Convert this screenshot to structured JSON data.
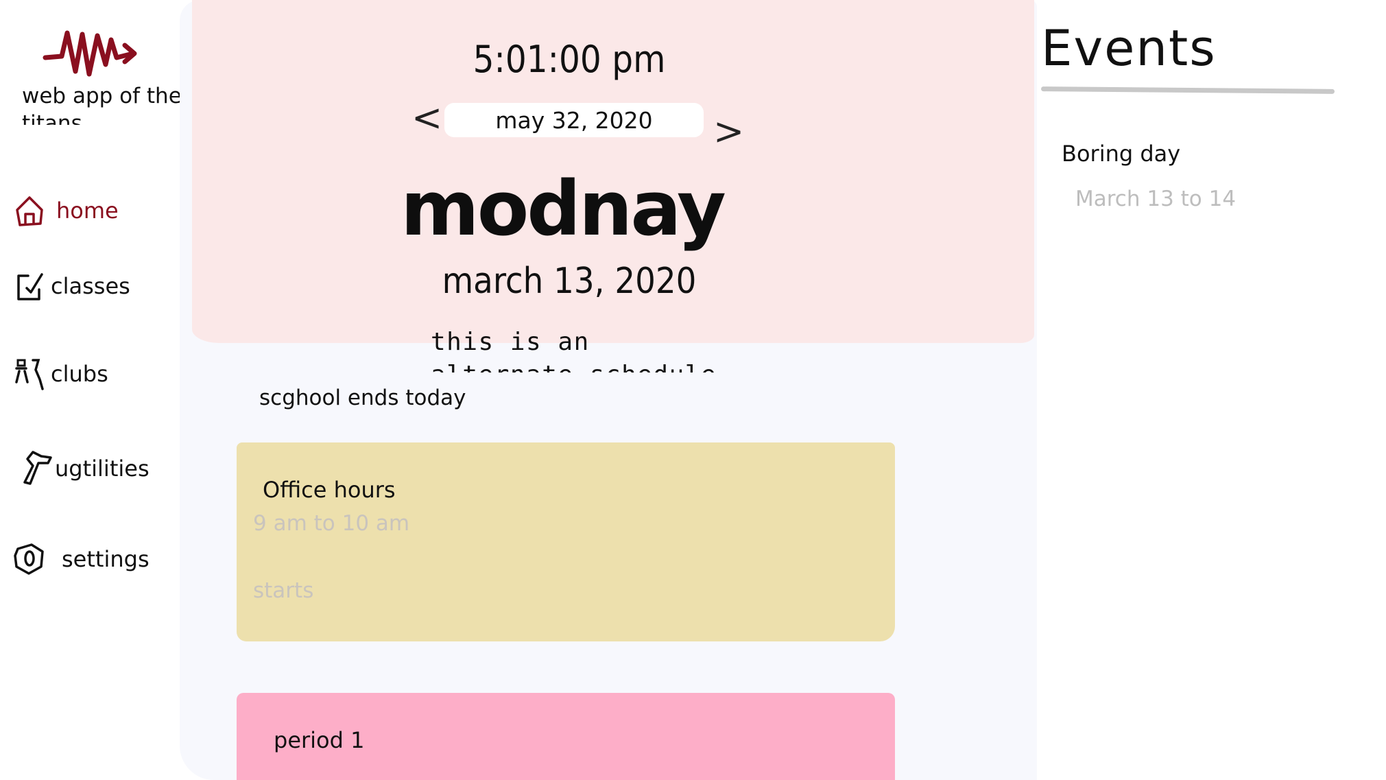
{
  "sidebar": {
    "logo_text": "web app of the titans",
    "items": [
      {
        "label": "home",
        "icon": "home-icon",
        "active": true
      },
      {
        "label": "classes",
        "icon": "classes-icon",
        "active": false
      },
      {
        "label": "clubs",
        "icon": "clubs-icon",
        "active": false
      },
      {
        "label": "ugtilities",
        "icon": "utilities-icon",
        "active": false
      },
      {
        "label": "settings",
        "icon": "settings-icon",
        "active": false
      }
    ]
  },
  "hero": {
    "time": "5:01:00 pm",
    "selected_date": "may 32, 2020",
    "prev_arrow": "<",
    "next_arrow": ">",
    "day_name": "modnay",
    "day_date": "march 13, 2020",
    "schedule_note": "this is an alternate schedule"
  },
  "main": {
    "notice": "scghool ends today",
    "cards": [
      {
        "title": "Office hours",
        "time": "9 am to 10 am",
        "starts": "starts",
        "color": "#ede0ad"
      },
      {
        "title": "period 1",
        "color": "#fdaec8"
      }
    ]
  },
  "events": {
    "title": "Events",
    "items": [
      {
        "name": "Boring day",
        "range": "March 13 to 14"
      }
    ]
  },
  "colors": {
    "accent": "#8a0f1f",
    "hero_bg": "#fbe8e8",
    "center_bg": "#f7f8fd"
  }
}
